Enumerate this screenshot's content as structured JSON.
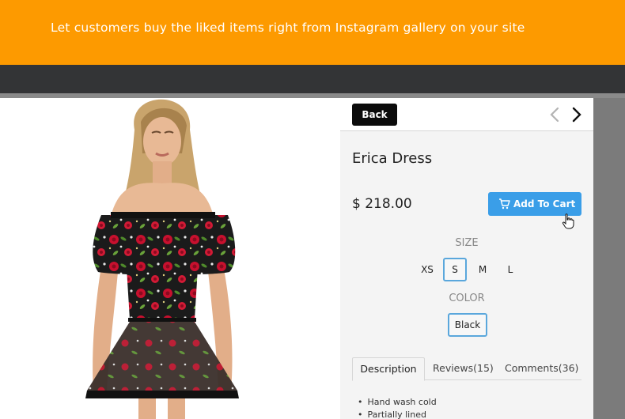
{
  "banner": {
    "text": "Let customers buy the liked items right from Instagram gallery on your site"
  },
  "product": {
    "back_label": "Back",
    "prev_icon": "chevron-left-icon",
    "next_icon": "chevron-right-icon",
    "name": "Erica Dress",
    "price": "$ 218.00",
    "add_to_cart_label": "Add To Cart",
    "cart_icon": "cart-icon",
    "size_label": "SIZE",
    "sizes": [
      "XS",
      "S",
      "M",
      "L"
    ],
    "selected_size": "S",
    "color_label": "COLOR",
    "colors": [
      "Black"
    ],
    "selected_color": "Black",
    "tabs": [
      {
        "label": "Description",
        "active": true
      },
      {
        "label": "Reviews(15)",
        "active": false
      },
      {
        "label": "Comments(36)",
        "active": false
      }
    ],
    "description_items": [
      "Hand wash cold",
      "Partially lined"
    ]
  },
  "colors": {
    "banner": "#fd9a00",
    "accent": "#3a9ee8",
    "selection_border": "#5aa7dc",
    "dress_base": "#1b1b1b",
    "rose": "#c8102e",
    "leaf": "#4f8a2b"
  }
}
